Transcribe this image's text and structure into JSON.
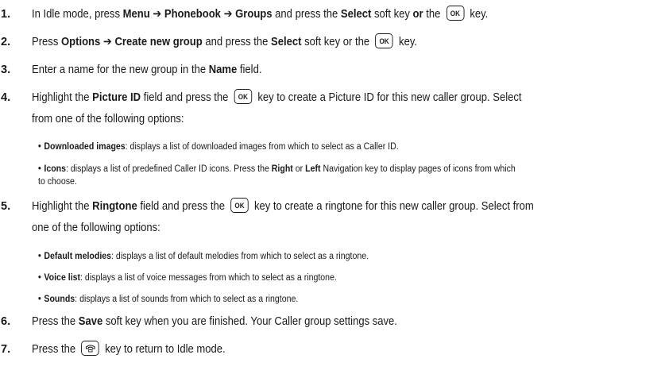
{
  "steps": [
    {
      "num": "1.",
      "parts": {
        "a": "In Idle mode, press ",
        "b1": "Menu",
        "arrow1": " ➔ ",
        "b2": "Phonebook",
        "arrow2": " ➔ ",
        "b3": "Groups",
        "c": " and press the ",
        "b4": "Select",
        "d": " soft key ",
        "b5": "or",
        "e": " the ",
        "key": "OK",
        "f": " key."
      }
    },
    {
      "num": "2.",
      "parts": {
        "a": "Press ",
        "b1": "Options",
        "arrow1": " ➔ ",
        "b2": "Create new group",
        "c": " and press the ",
        "b3": "Select",
        "d": " soft key or the ",
        "key": "OK",
        "e": " key."
      }
    },
    {
      "num": "3.",
      "parts": {
        "a": "Enter a name for the new group in the ",
        "b1": "Name",
        "c": " field."
      }
    },
    {
      "num": "4.",
      "parts": {
        "a": "Highlight the ",
        "b1": "Picture ID",
        "c": " field and press the ",
        "key": "OK",
        "d": " key to create a Picture ID for this new caller group. Select",
        "line2": "from one of the following options:"
      },
      "bullets": [
        {
          "title": "Downloaded images",
          "text": ": displays a list of downloaded images from which to select as a Caller ID."
        },
        {
          "title": "Icons",
          "text_a": ": displays a list of predefined Caller ID icons. Press the ",
          "b1": "Right",
          "text_b": " or ",
          "b2": "Left",
          "text_c": " Navigation key to display pages of icons from which",
          "line2": "to choose."
        }
      ]
    },
    {
      "num": "5.",
      "parts": {
        "a": "Highlight the ",
        "b1": "Ringtone",
        "c": " field and press the ",
        "key": "OK",
        "d": " key to create a ringtone for this new caller group. Select from",
        "line2": "one of the following options:"
      },
      "bullets": [
        {
          "title": "Default melodies",
          "text": ": displays a list of default melodies from which to select as a ringtone."
        },
        {
          "title": "Voice list",
          "text": ": displays a list of voice messages from which to select as a ringtone."
        },
        {
          "title": "Sounds",
          "text": ": displays a list of sounds from which to select as a ringtone."
        }
      ]
    },
    {
      "num": "6.",
      "parts": {
        "a": "Press the ",
        "b1": "Save",
        "c": " soft key when you are finished. Your Caller group settings save."
      }
    },
    {
      "num": "7.",
      "parts": {
        "a": "Press the ",
        "key": "end-key",
        "c": " key to return to Idle mode."
      }
    }
  ],
  "bullet_char": "•"
}
